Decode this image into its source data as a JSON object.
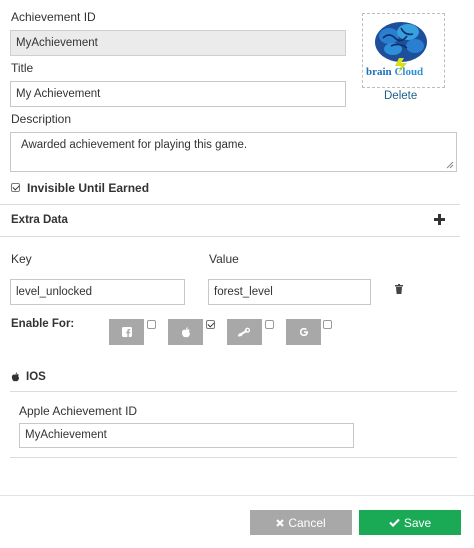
{
  "form": {
    "achievement_id_label": "Achievement ID",
    "achievement_id_value": "MyAchievement",
    "title_label": "Title",
    "title_value": "My Achievement",
    "description_label": "Description",
    "description_value": "Awarded achievement for playing this game.",
    "invisible_label": "Invisible Until Earned",
    "invisible_checked": true
  },
  "image": {
    "brand_left": "brain",
    "brand_right": "Cloud",
    "delete_label": "Delete"
  },
  "extra_data": {
    "section_label": "Extra Data",
    "key_label": "Key",
    "value_label": "Value",
    "key_value": "level_unlocked",
    "value_value": "forest_level"
  },
  "enable_for": {
    "label": "Enable For:",
    "platforms": [
      {
        "icon": "facebook-icon",
        "checked": false
      },
      {
        "icon": "apple-icon",
        "checked": true
      },
      {
        "icon": "steam-icon",
        "checked": false
      },
      {
        "icon": "google-icon",
        "checked": false
      }
    ]
  },
  "ios": {
    "section_label": "IOS",
    "apple_id_label": "Apple Achievement ID",
    "apple_id_value": "MyAchievement"
  },
  "footer": {
    "cancel_label": "Cancel",
    "save_label": "Save"
  },
  "colors": {
    "save_green": "#1aaa55",
    "cancel_gray": "#a8a8a8",
    "link_blue": "#1f5f8b"
  }
}
